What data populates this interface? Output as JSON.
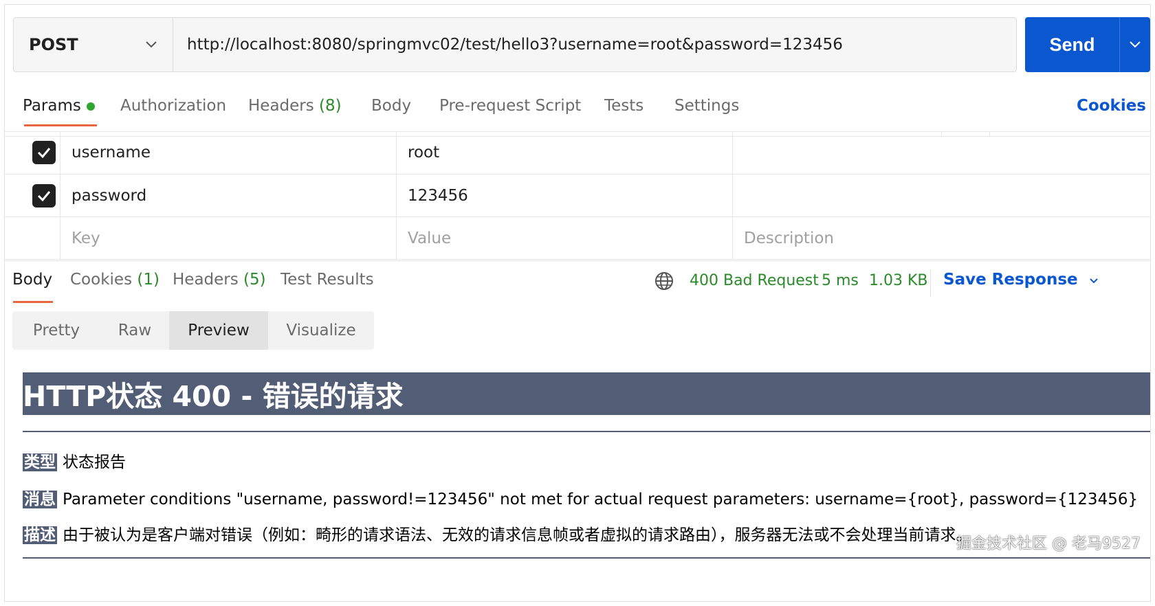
{
  "request": {
    "method": "POST",
    "url": "http://localhost:8080/springmvc02/test/hello3?username=root&password=123456",
    "send_label": "Send"
  },
  "req_tabs": {
    "params": "Params",
    "authorization": "Authorization",
    "headers": "Headers",
    "headers_count": "(8)",
    "body": "Body",
    "prerequest": "Pre-request Script",
    "tests": "Tests",
    "settings": "Settings",
    "cookies": "Cookies"
  },
  "params": {
    "rows": [
      {
        "key": "username",
        "value": "root",
        "checked": true
      },
      {
        "key": "password",
        "value": "123456",
        "checked": true
      }
    ],
    "placeholder_key": "Key",
    "placeholder_value": "Value",
    "placeholder_description": "Description"
  },
  "response": {
    "tabs": {
      "body": "Body",
      "cookies": "Cookies",
      "cookies_count": "(1)",
      "headers": "Headers",
      "headers_count": "(5)",
      "test_results": "Test Results"
    },
    "status": "400 Bad Request",
    "time": "5 ms",
    "size": "1.03 KB",
    "save_response": "Save Response",
    "modes": [
      "Pretty",
      "Raw",
      "Preview",
      "Visualize"
    ],
    "active_mode": "Preview"
  },
  "preview": {
    "title": "HTTP状态 400 - 错误的请求",
    "type_label": "类型",
    "type_value": "状态报告",
    "message_label": "消息",
    "message_value": "Parameter conditions \"username, password!=123456\" not met for actual request parameters: username={root}, password={123456}",
    "description_label": "描述",
    "description_value": "由于被认为是客户端对错误（例如：畸形的请求语法、无效的请求信息帧或者虚拟的请求路由），服务器无法或不会处理当前请求。"
  },
  "watermark": "掘金技术社区 @ 老马9527",
  "colors": {
    "accent": "#0b57d0",
    "tab_underline": "#e8663d",
    "success_green": "#2a8a2a",
    "preview_header": "#525d76"
  }
}
